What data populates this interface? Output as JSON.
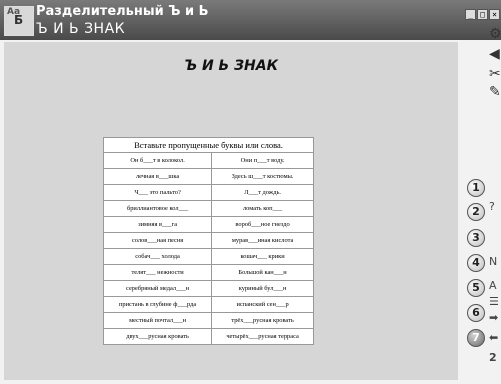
{
  "window": {
    "app_icon_letters": "Aа",
    "app_icon_letters2": "Б",
    "title_line1": "Разделительный Ъ и Ь",
    "title_line2": "Ъ И Ь ЗНАК",
    "buttons": [
      "_",
      "□",
      "×"
    ]
  },
  "content": {
    "heading": "Ъ И Ь ЗНАК",
    "instruction": "Вставьте пропущенные буквы или слова.",
    "rows": [
      [
        "Он б___т в колокол.",
        "Они п___т воду."
      ],
      [
        "лечная в___шка",
        "Здесь ш___т костюмы."
      ],
      [
        "Ч___ это пальто?",
        "Л___т дождь."
      ],
      [
        "бриллиантовое кол___",
        "ломать коп___"
      ],
      [
        "зимняя в___га",
        "вороб___ное гнездо"
      ],
      [
        "солов___ная песня",
        "мурав___иная кислота"
      ],
      [
        "собач___ холода",
        "кошач___ крики"
      ],
      [
        "телят___ нежности",
        "Большой кан___н"
      ],
      [
        "серебряный медал___н",
        "куриный бул___н"
      ],
      [
        "пристань в глубине ф___рда",
        "испанский сен___р"
      ],
      [
        "местный почтал___н",
        "трёх___русная кровать"
      ],
      [
        "двух___русная кровать",
        "четырёх___русная терраса"
      ]
    ]
  },
  "sidebar": {
    "tools": [
      "settings-icon",
      "sound-icon",
      "scissors-icon",
      "pencil-icon"
    ],
    "tool_glyphs": [
      "⚙",
      "◀",
      "✂",
      "✎"
    ],
    "steps": [
      "1",
      "2",
      "3",
      "4",
      "5",
      "6",
      "7"
    ],
    "active_step": "7",
    "step_side_glyphs": [
      "",
      "?",
      "",
      "N",
      "A",
      "☰",
      "➡",
      "⬅"
    ],
    "bottom_number": "2"
  }
}
